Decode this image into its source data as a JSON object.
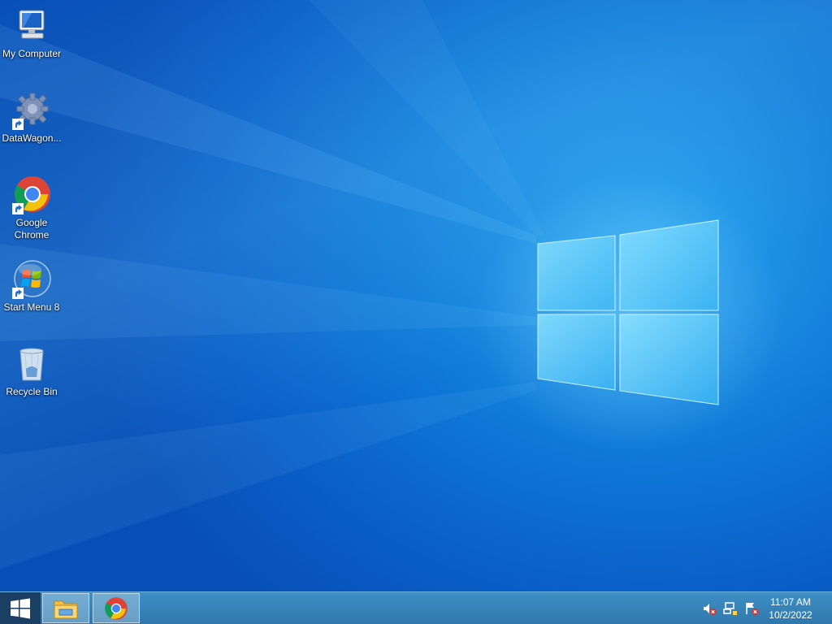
{
  "desktop": {
    "icons": [
      {
        "label": "My Computer",
        "icon": "my-computer-icon"
      },
      {
        "label": "DataWagon...",
        "icon": "datawagon-gear-icon"
      },
      {
        "label": "Google Chrome",
        "icon": "chrome-icon"
      },
      {
        "label": "Start Menu 8",
        "icon": "start-menu-8-icon"
      },
      {
        "label": "Recycle Bin",
        "icon": "recycle-bin-icon"
      }
    ],
    "wallpaper": "windows-10-hero"
  },
  "taskbar": {
    "start_icon": "windows-logo-icon",
    "pinned": [
      {
        "icon": "file-explorer-icon"
      },
      {
        "icon": "chrome-icon"
      }
    ],
    "tray": [
      {
        "icon": "volume-muted-icon"
      },
      {
        "icon": "network-disconnected-icon"
      },
      {
        "icon": "action-center-flag-icon"
      }
    ],
    "time": "11:07 AM",
    "date": "10/2/2022"
  },
  "colors": {
    "desktop_bg": "#0f7ad8",
    "taskbar_bg": "#3585b9",
    "start_bg": "#1b3f63"
  }
}
